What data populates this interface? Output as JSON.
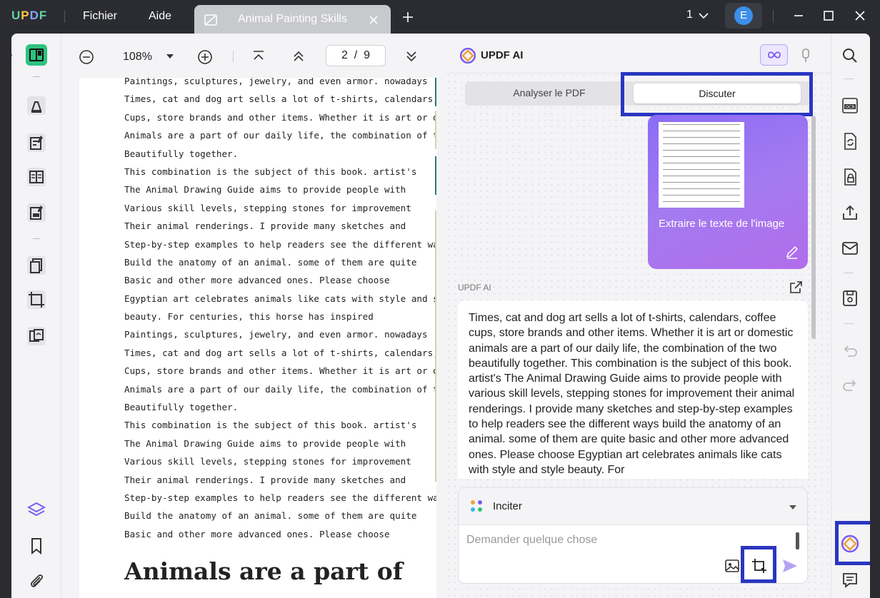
{
  "app": {
    "logo": "UPDF",
    "menu": [
      "Fichier",
      "Aide"
    ],
    "tab_title": "Animal Painting Skills",
    "page_count_display": "1",
    "avatar_initial": "E"
  },
  "doc_toolbar": {
    "zoom": "108%",
    "page_current": "2",
    "page_total": "9"
  },
  "document": {
    "lines": [
      "Paintings, sculptures, jewelry, and even armor. nowadays",
      "Times, cat and dog art sells a lot of t-shirts, calendars, coffee",
      "Cups, store brands and other items. Whether it is art or domestic",
      "Animals are a part of our daily life, the combination of the two",
      "Beautifully together.",
      "This combination is the subject of this book. artist's",
      "The Animal Drawing Guide aims to provide people with",
      "Various skill levels, stepping stones for improvement",
      "Their animal renderings. I provide many sketches and",
      "Step-by-step examples to help readers see the different ways",
      "Build the anatomy of an animal. some of them are quite",
      "Basic and other more advanced ones. Please choose",
      "Egyptian art celebrates animals like cats with style and style",
      "beauty. For centuries, this horse has inspired",
      "Paintings, sculptures, jewelry, and even armor. nowadays",
      "Times, cat and dog art sells a lot of t-shirts, calendars, coffee",
      "Cups, store brands and other items. Whether it is art or domestic",
      "Animals are a part of our daily life, the combination of the two",
      "Beautifully together.",
      "This combination is the subject of this book. artist's",
      "The Animal Drawing Guide aims to provide people with",
      "Various skill levels, stepping stones for improvement",
      "Their animal renderings. I provide many sketches and",
      "Step-by-step examples to help readers see the different ways",
      "Build the anatomy of an animal. some of them are quite",
      "Basic and other more advanced ones. Please choose"
    ],
    "heading": "Animals are a part of"
  },
  "ai_panel": {
    "title": "UPDF AI",
    "tab_analyze": "Analyser le PDF",
    "tab_chat": "Discuter",
    "user_bubble_text": "Extraire le texte de l'image",
    "response_label": "UPDF AI",
    "response_text": "Times, cat and dog art sells a lot of t-shirts, calendars, coffee cups, store brands and other items. Whether it is art or domestic animals are a part of our daily life, the combination of the two beautifully together. This combination is the subject of this book. artist's The Animal Drawing Guide aims to provide people with various skill levels, stepping stones for improvement their animal renderings. I provide many sketches and step-by-step examples to help readers see the different ways build the anatomy of an animal. some of them are quite basic and other more advanced ones. Please choose Egyptian art celebrates animals like cats with style and style beauty. For",
    "prompt_label": "Inciter",
    "input_placeholder": "Demander quelque chose"
  },
  "colors": {
    "highlight": "#2a36c0",
    "accent_green": "#2ec27e",
    "accent_purple": "#8a6cf6"
  },
  "icons": {
    "left_sidebar": [
      "reader-icon",
      "comment-icon",
      "edit-icon",
      "page-layout-icon",
      "fill-sign-icon",
      "organize-pages-icon",
      "crop-icon",
      "compare-icon",
      "layers-icon",
      "bookmark-icon",
      "attachment-icon"
    ],
    "right_sidebar": [
      "search-icon",
      "ocr-icon",
      "convert-icon",
      "protect-icon",
      "share-icon",
      "email-icon",
      "save-icon",
      "undo-icon",
      "redo-icon",
      "updf-ai-icon",
      "comments-list-icon"
    ]
  }
}
